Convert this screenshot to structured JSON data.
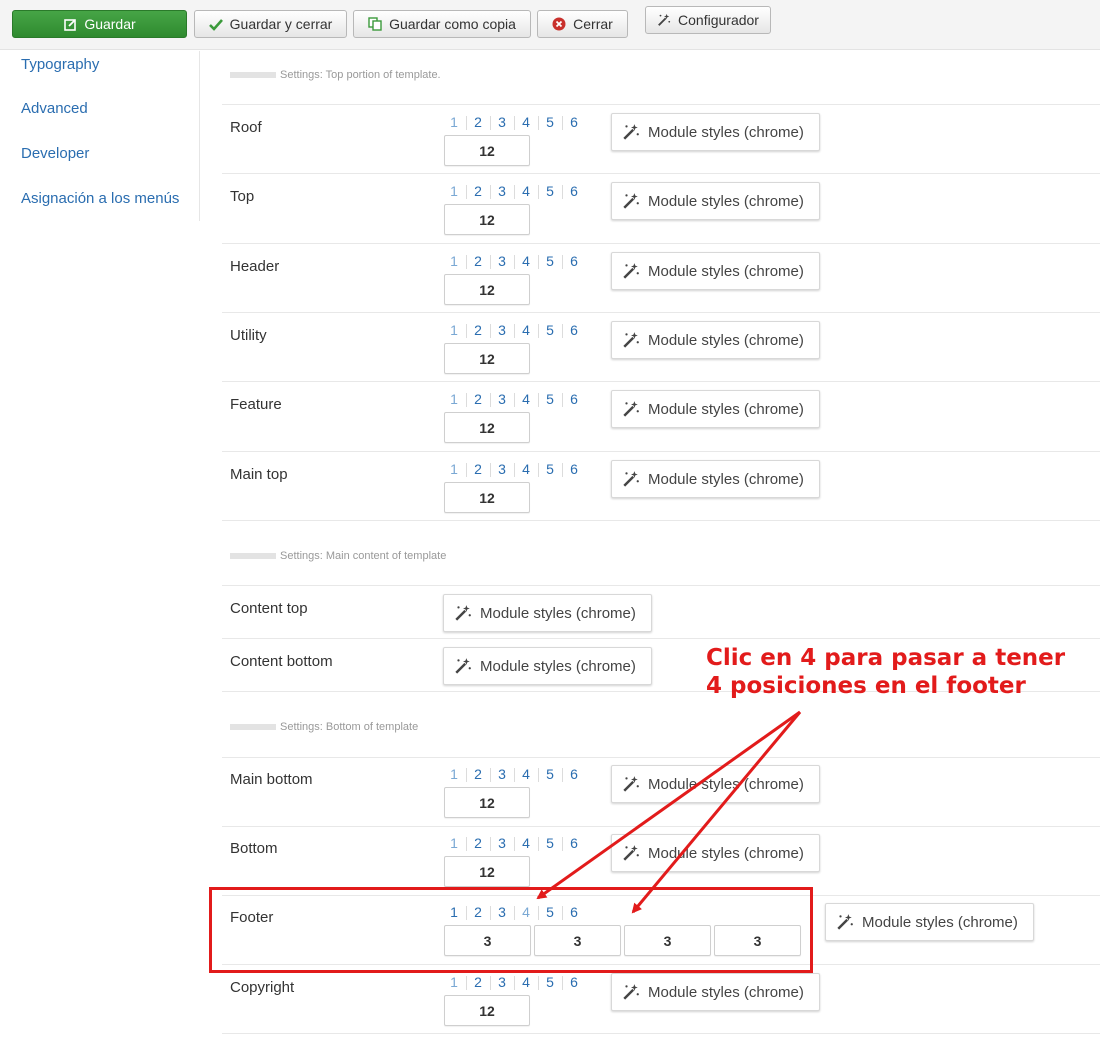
{
  "toolbar": {
    "save": "Guardar",
    "save_close": "Guardar y cerrar",
    "save_copy": "Guardar como copia",
    "close": "Cerrar",
    "configurator": "Configurador"
  },
  "sidebar": {
    "items": [
      "Typography",
      "Advanced",
      "Developer",
      "Asignación a los menús"
    ]
  },
  "sections": {
    "top": "Settings: Top portion of template.",
    "main": "Settings: Main content of template",
    "bottom": "Settings: Bottom of template"
  },
  "column_options": [
    "1",
    "2",
    "3",
    "4",
    "5",
    "6"
  ],
  "module_styles_label": "Module styles (chrome)",
  "rows": [
    {
      "label": "Roof",
      "columns": [
        "12"
      ]
    },
    {
      "label": "Top",
      "columns": [
        "12"
      ]
    },
    {
      "label": "Header",
      "columns": [
        "12"
      ]
    },
    {
      "label": "Utility",
      "columns": [
        "12"
      ]
    },
    {
      "label": "Feature",
      "columns": [
        "12"
      ]
    },
    {
      "label": "Main top",
      "columns": [
        "12"
      ]
    },
    {
      "label": "Content top",
      "columns": []
    },
    {
      "label": "Content bottom",
      "columns": []
    },
    {
      "label": "Main bottom",
      "columns": [
        "12"
      ]
    },
    {
      "label": "Bottom",
      "columns": [
        "12"
      ]
    },
    {
      "label": "Footer",
      "columns": [
        "3",
        "3",
        "3",
        "3"
      ]
    },
    {
      "label": "Copyright",
      "columns": [
        "12"
      ]
    }
  ],
  "annotation": {
    "line1": "Clic en 4 para pasar a tener",
    "line2": "4 posiciones en el footer"
  },
  "colors": {
    "link": "#2a6db0",
    "primary_button": "#3b9a3b",
    "annotation": "#e21b1b"
  }
}
